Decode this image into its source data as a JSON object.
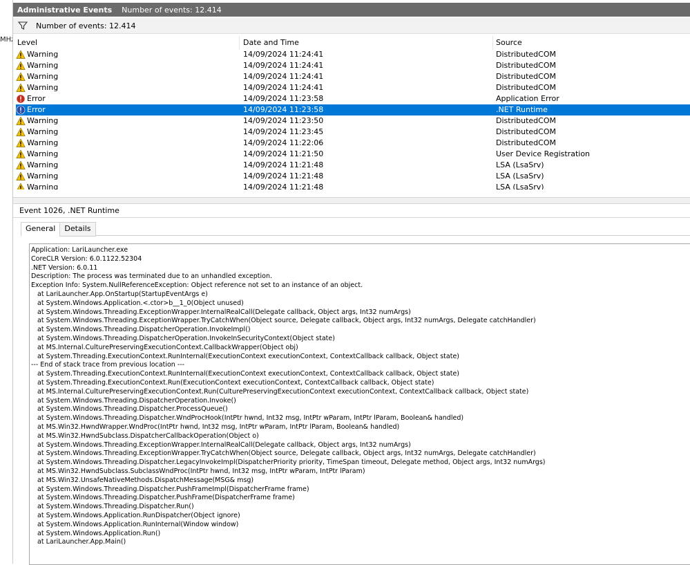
{
  "left_strip_text": "MHz",
  "titlebar": {
    "title": "Administrative Events",
    "count_label": "Number of events: 12.414"
  },
  "filter": {
    "icon": "funnel-icon",
    "text": "Number of events: 12.414"
  },
  "grid": {
    "columns": [
      "Level",
      "Date and Time",
      "Source"
    ],
    "rows": [
      {
        "level": "Warning",
        "icon": "warning-icon",
        "datetime": "14/09/2024 11:24:41",
        "source": "DistributedCOM"
      },
      {
        "level": "Warning",
        "icon": "warning-icon",
        "datetime": "14/09/2024 11:24:41",
        "source": "DistributedCOM"
      },
      {
        "level": "Warning",
        "icon": "warning-icon",
        "datetime": "14/09/2024 11:24:41",
        "source": "DistributedCOM"
      },
      {
        "level": "Warning",
        "icon": "warning-icon",
        "datetime": "14/09/2024 11:24:41",
        "source": "DistributedCOM"
      },
      {
        "level": "Error",
        "icon": "error-icon",
        "datetime": "14/09/2024 11:23:58",
        "source": "Application Error"
      },
      {
        "level": "Error",
        "icon": "error-icon",
        "datetime": "14/09/2024 11:23:58",
        "source": ".NET Runtime",
        "selected": true
      },
      {
        "level": "Warning",
        "icon": "warning-icon",
        "datetime": "14/09/2024 11:23:50",
        "source": "DistributedCOM"
      },
      {
        "level": "Warning",
        "icon": "warning-icon",
        "datetime": "14/09/2024 11:23:45",
        "source": "DistributedCOM"
      },
      {
        "level": "Warning",
        "icon": "warning-icon",
        "datetime": "14/09/2024 11:22:06",
        "source": "DistributedCOM"
      },
      {
        "level": "Warning",
        "icon": "warning-icon",
        "datetime": "14/09/2024 11:21:50",
        "source": "User Device Registration"
      },
      {
        "level": "Warning",
        "icon": "warning-icon",
        "datetime": "14/09/2024 11:21:48",
        "source": "LSA (LsaSrv)"
      },
      {
        "level": "Warning",
        "icon": "warning-icon",
        "datetime": "14/09/2024 11:21:48",
        "source": "LSA (LsaSrv)"
      },
      {
        "level": "Warning",
        "icon": "warning-icon",
        "datetime": "14/09/2024 11:21:48",
        "source": "LSA (LsaSrv)"
      }
    ]
  },
  "event_header": "Event 1026, .NET Runtime",
  "tabs": [
    "General",
    "Details"
  ],
  "description": "Application: LariLauncher.exe\nCoreCLR Version: 6.0.1122.52304\n.NET Version: 6.0.11\nDescription: The process was terminated due to an unhandled exception.\nException Info: System.NullReferenceException: Object reference not set to an instance of an object.\n   at LariLauncher.App.OnStartup(StartupEventArgs e)\n   at System.Windows.Application.<.ctor>b__1_0(Object unused)\n   at System.Windows.Threading.ExceptionWrapper.InternalRealCall(Delegate callback, Object args, Int32 numArgs)\n   at System.Windows.Threading.ExceptionWrapper.TryCatchWhen(Object source, Delegate callback, Object args, Int32 numArgs, Delegate catchHandler)\n   at System.Windows.Threading.DispatcherOperation.InvokeImpl()\n   at System.Windows.Threading.DispatcherOperation.InvokeInSecurityContext(Object state)\n   at MS.Internal.CulturePreservingExecutionContext.CallbackWrapper(Object obj)\n   at System.Threading.ExecutionContext.RunInternal(ExecutionContext executionContext, ContextCallback callback, Object state)\n--- End of stack trace from previous location ---\n   at System.Threading.ExecutionContext.RunInternal(ExecutionContext executionContext, ContextCallback callback, Object state)\n   at System.Threading.ExecutionContext.Run(ExecutionContext executionContext, ContextCallback callback, Object state)\n   at MS.Internal.CulturePreservingExecutionContext.Run(CulturePreservingExecutionContext executionContext, ContextCallback callback, Object state)\n   at System.Windows.Threading.DispatcherOperation.Invoke()\n   at System.Windows.Threading.Dispatcher.ProcessQueue()\n   at System.Windows.Threading.Dispatcher.WndProcHook(IntPtr hwnd, Int32 msg, IntPtr wParam, IntPtr lParam, Boolean& handled)\n   at MS.Win32.HwndWrapper.WndProc(IntPtr hwnd, Int32 msg, IntPtr wParam, IntPtr lParam, Boolean& handled)\n   at MS.Win32.HwndSubclass.DispatcherCallbackOperation(Object o)\n   at System.Windows.Threading.ExceptionWrapper.InternalRealCall(Delegate callback, Object args, Int32 numArgs)\n   at System.Windows.Threading.ExceptionWrapper.TryCatchWhen(Object source, Delegate callback, Object args, Int32 numArgs, Delegate catchHandler)\n   at System.Windows.Threading.Dispatcher.LegacyInvokeImpl(DispatcherPriority priority, TimeSpan timeout, Delegate method, Object args, Int32 numArgs)\n   at MS.Win32.HwndSubclass.SubclassWndProc(IntPtr hwnd, Int32 msg, IntPtr wParam, IntPtr lParam)\n   at MS.Win32.UnsafeNativeMethods.DispatchMessage(MSG& msg)\n   at System.Windows.Threading.Dispatcher.PushFrameImpl(DispatcherFrame frame)\n   at System.Windows.Threading.Dispatcher.PushFrame(DispatcherFrame frame)\n   at System.Windows.Threading.Dispatcher.Run()\n   at System.Windows.Application.RunDispatcher(Object ignore)\n   at System.Windows.Application.RunInternal(Window window)\n   at System.Windows.Application.Run()\n   at LariLauncher.App.Main()",
  "colors": {
    "title_bg": "#6b6b6b",
    "selected_row": "#0078d7",
    "warning": "#f5c400",
    "error": "#c42b1c"
  }
}
